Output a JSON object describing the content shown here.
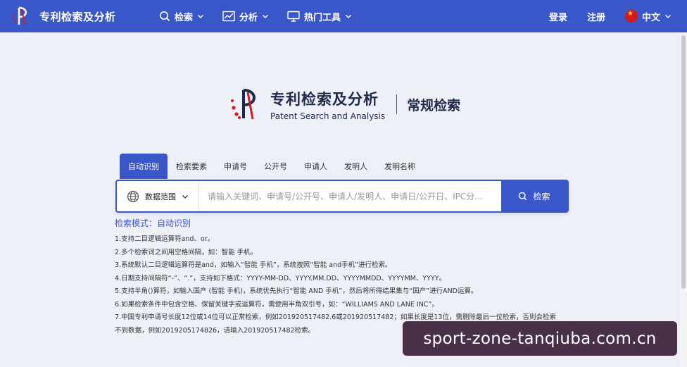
{
  "header": {
    "brand_name": "专利检索及分析",
    "nav": [
      {
        "label": "检索"
      },
      {
        "label": "分析"
      },
      {
        "label": "热门工具"
      }
    ],
    "login": "登录",
    "register": "注册",
    "language": "中文"
  },
  "hero": {
    "cn_title": "专利检索及分析",
    "en_title": "Patent Search and Analysis",
    "mode_title": "常规检索"
  },
  "tabs": [
    "自动识别",
    "检索要素",
    "申请号",
    "公开号",
    "申请人",
    "发明人",
    "发明名称"
  ],
  "search": {
    "scope_label": "数据范围",
    "placeholder": "请输入关键词、申请号/公开号、申请人/发明人、申请日/公开日、IPC分...",
    "button_label": "检索"
  },
  "help": {
    "mode_text": "检索模式：自动识别",
    "tips": [
      "1.支持二目逻辑运算符and、or。",
      "2.多个检索词之间用空格间隔，如：智能 手机。",
      "3.系统默认二目逻辑运算符是and，如输入“智能 手机”，系统按照“智能 and手机”进行检索。",
      "4.日期支持间隔符“-”、“.”，支持如下格式：YYYY-MM-DD、YYYY.MM.DD、YYYYMMDD、YYYYMM、YYYY。",
      "5.支持半角()算符，如输入国产 (智能 手机)，系统优先执行“智能 AND 手机”，然后将所得结果集与“国产”进行AND运算。",
      "6.如果检索条件中包含空格、保留关键字或运算符，需使用半角双引号，如：“WILLIAMS AND LANE INC”。",
      "7.中国专利申请号长度12位或14位可以正常检索，例如201920517482.6或201920517482；如果长度是13位，需删除最后一位检索，否则会检索",
      "不到数据，例如2019205174826，请输入201920517482检索。"
    ]
  },
  "watermark": "sport-zone-tanqiuba.com.cn",
  "colors": {
    "accent": "#3a57c9",
    "background": "#eef0f8"
  }
}
